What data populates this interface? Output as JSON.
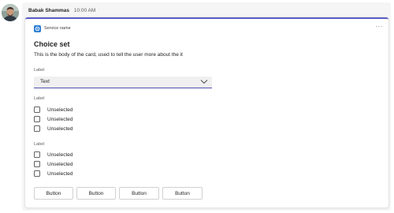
{
  "message": {
    "sender": "Babak Shammas",
    "time": "10:00 AM"
  },
  "card": {
    "service_name": "Service name",
    "more_label": "···",
    "title": "Choice set",
    "body": "This is the body of the card, used to tell the user more about the it",
    "dropdown": {
      "label": "Label",
      "value": "Text"
    },
    "choice_sets": [
      {
        "label": "Label",
        "options": [
          "Unselected",
          "Unselected",
          "Unselected"
        ]
      },
      {
        "label": "Label",
        "options": [
          "Unselected",
          "Unselected",
          "Unselected"
        ]
      }
    ],
    "buttons": [
      "Button",
      "Button",
      "Button",
      "Button"
    ]
  },
  "colors": {
    "accent": "#5b5fc7",
    "service_icon": "#2b7cd3",
    "message_background": "#f5f5f5"
  },
  "icons": {
    "service": "service-app-icon",
    "dropdown": "chevron-down-icon",
    "more": "more-options-icon"
  }
}
